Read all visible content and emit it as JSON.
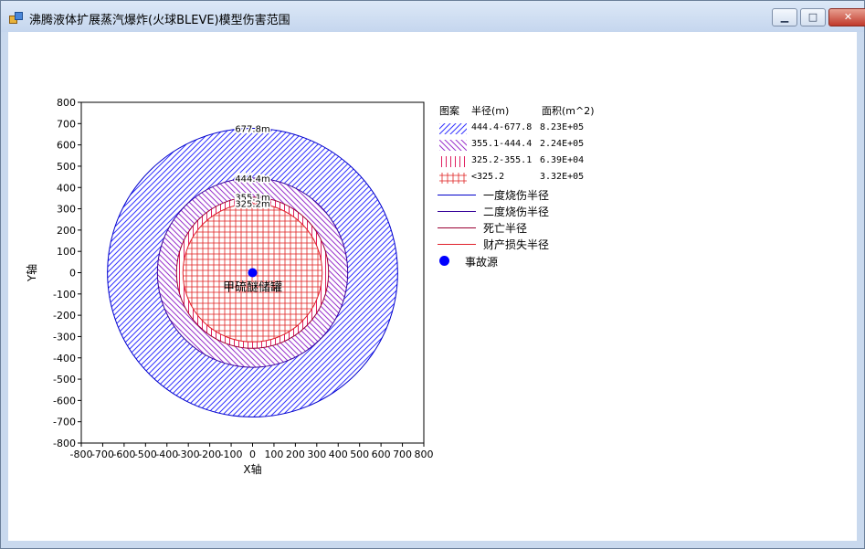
{
  "window": {
    "title": "沸腾液体扩展蒸汽爆炸(火球BLEVE)模型伤害范围",
    "min_glyph": "▁",
    "max_glyph": "□",
    "close_glyph": "✕"
  },
  "chart_data": {
    "type": "scatter",
    "xlabel": "X轴",
    "ylabel": "Y轴",
    "xlim": [
      -800,
      800
    ],
    "ylim": [
      -800,
      800
    ],
    "xticks": [
      -800,
      -700,
      -600,
      -500,
      -400,
      -300,
      -200,
      -100,
      0,
      100,
      200,
      300,
      400,
      500,
      600,
      700,
      800
    ],
    "yticks": [
      800,
      700,
      600,
      500,
      400,
      300,
      200,
      100,
      0,
      -100,
      -200,
      -300,
      -400,
      -500,
      -600,
      -700,
      -800
    ],
    "grid": false,
    "legend_position": "right",
    "circles": [
      {
        "name": "一度烧伤半径",
        "radius": 677.8,
        "label": "677.8m",
        "color": "#0000cc",
        "fill": "diag-fwd"
      },
      {
        "name": "二度烧伤半径",
        "radius": 444.4,
        "label": "444.4m",
        "color": "#330099",
        "fill": "diag-back"
      },
      {
        "name": "死亡半径",
        "radius": 355.1,
        "label": "355.1m",
        "color": "#990033",
        "fill": "vertical"
      },
      {
        "name": "财产损失半径",
        "radius": 325.2,
        "label": "325.2m",
        "color": "#e0202a",
        "fill": "grid"
      }
    ],
    "source": {
      "name": "事故源",
      "x": 0,
      "y": 0,
      "label": "甲硫醚储罐",
      "color": "#0000ff"
    }
  },
  "legend": {
    "header_pattern": "图案",
    "header_radius": "半径(m)",
    "header_area": "面积(m^2)",
    "rows": [
      {
        "range": "444.4-677.8",
        "area": "8.23E+05",
        "pattern": "diag-fwd",
        "color": "#3333ff"
      },
      {
        "range": "355.1-444.4",
        "area": "2.24E+05",
        "pattern": "diag-back",
        "color": "#9933cc"
      },
      {
        "range": "325.2-355.1",
        "area": "6.39E+04",
        "pattern": "vertical",
        "color": "#e02060"
      },
      {
        "range": "<325.2",
        "area": "3.32E+05",
        "pattern": "grid",
        "color": "#e02020"
      }
    ],
    "lines": [
      {
        "label": "一度烧伤半径",
        "color": "#0000cc"
      },
      {
        "label": "二度烧伤半径",
        "color": "#330099"
      },
      {
        "label": "死亡半径",
        "color": "#990033"
      },
      {
        "label": "财产损失半径",
        "color": "#e0202a"
      }
    ],
    "source_label": "事故源",
    "source_color": "#0000ff"
  }
}
